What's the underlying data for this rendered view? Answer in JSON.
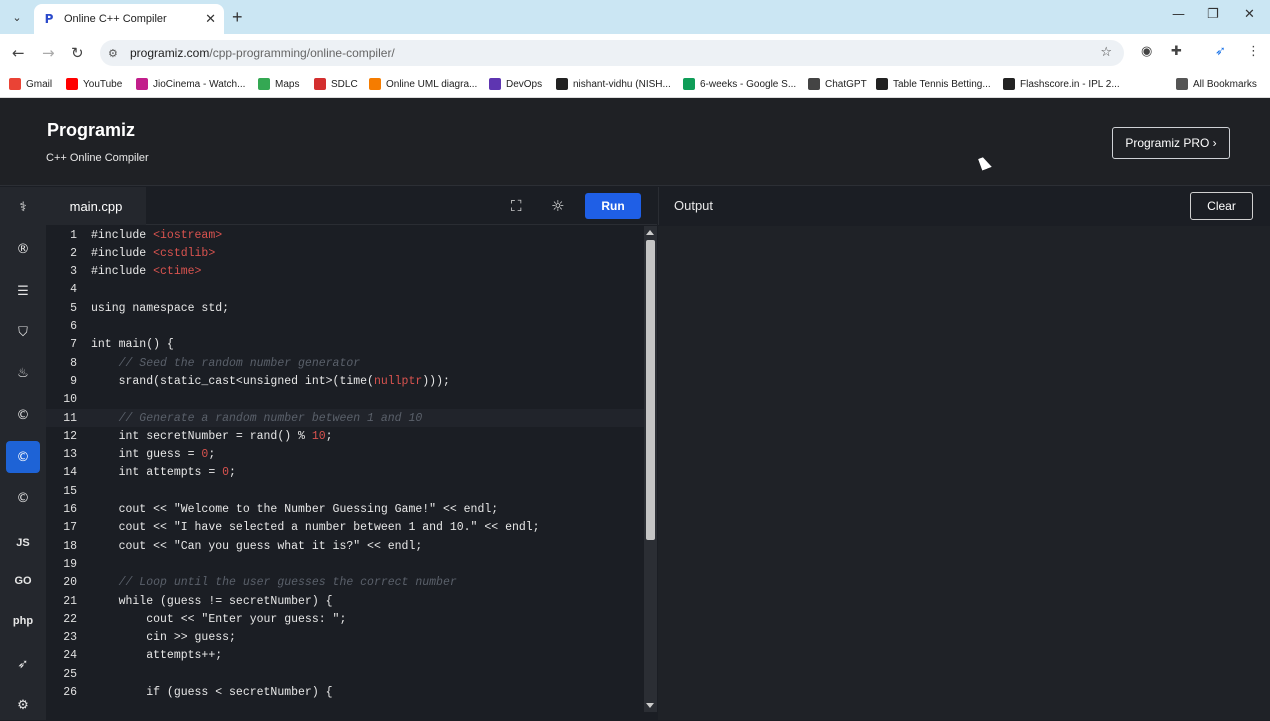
{
  "browser": {
    "tab_title": "Online C++ Compiler",
    "url_domain": "programiz.com",
    "url_path": "/cpp-programming/online-compiler/"
  },
  "bookmarks": [
    {
      "label": "Gmail",
      "color": "#ea4335"
    },
    {
      "label": "YouTube",
      "color": "#ff0000"
    },
    {
      "label": "JioCinema - Watch...",
      "color": "#c21e8b"
    },
    {
      "label": "Maps",
      "color": "#34a853"
    },
    {
      "label": "SDLC",
      "color": "#d32f2f"
    },
    {
      "label": "Online UML diagra...",
      "color": "#f57c00"
    },
    {
      "label": "DevOps",
      "color": "#5e35b1"
    },
    {
      "label": "nishant-vidhu (NISH...",
      "color": "#222222"
    },
    {
      "label": "6-weeks - Google S...",
      "color": "#0f9d58"
    },
    {
      "label": "ChatGPT",
      "color": "#444444"
    },
    {
      "label": "Table Tennis Betting...",
      "color": "#222222"
    },
    {
      "label": "Flashscore.in - IPL 2...",
      "color": "#222222"
    },
    {
      "label": "All Bookmarks",
      "color": "#555555"
    }
  ],
  "header": {
    "logo": "Programiz",
    "subtitle": "C++ Online Compiler",
    "pro_button": "Programiz PRO ›"
  },
  "editor": {
    "file_tab": "main.cpp",
    "run_label": "Run",
    "lines": [
      {
        "n": "1",
        "segs": [
          {
            "c": "tx",
            "t": "#include "
          },
          {
            "c": "inc",
            "t": "<iostream>"
          }
        ]
      },
      {
        "n": "2",
        "segs": [
          {
            "c": "tx",
            "t": "#include "
          },
          {
            "c": "inc",
            "t": "<cstdlib>"
          }
        ]
      },
      {
        "n": "3",
        "segs": [
          {
            "c": "tx",
            "t": "#include "
          },
          {
            "c": "inc",
            "t": "<ctime>"
          }
        ]
      },
      {
        "n": "4",
        "segs": []
      },
      {
        "n": "5",
        "segs": [
          {
            "c": "tx",
            "t": "using namespace std;"
          }
        ]
      },
      {
        "n": "6",
        "segs": []
      },
      {
        "n": "7",
        "segs": [
          {
            "c": "tx",
            "t": "int main() {"
          }
        ]
      },
      {
        "n": "8",
        "segs": [
          {
            "c": "cm",
            "t": "    // Seed the random number generator"
          }
        ]
      },
      {
        "n": "9",
        "segs": [
          {
            "c": "tx",
            "t": "    srand(static_cast<unsigned int>(time("
          },
          {
            "c": "inc",
            "t": "nullptr"
          },
          {
            "c": "tx",
            "t": ")));"
          }
        ]
      },
      {
        "n": "10",
        "segs": []
      },
      {
        "n": "11",
        "segs": [
          {
            "c": "cm",
            "t": "    // Generate a random number between 1 and 10"
          }
        ]
      },
      {
        "n": "12",
        "segs": [
          {
            "c": "tx",
            "t": "    int secretNumber = rand() % "
          },
          {
            "c": "num",
            "t": "10"
          },
          {
            "c": "tx",
            "t": ";"
          }
        ]
      },
      {
        "n": "13",
        "segs": [
          {
            "c": "tx",
            "t": "    int guess = "
          },
          {
            "c": "num",
            "t": "0"
          },
          {
            "c": "tx",
            "t": ";"
          }
        ]
      },
      {
        "n": "14",
        "segs": [
          {
            "c": "tx",
            "t": "    int attempts = "
          },
          {
            "c": "num",
            "t": "0"
          },
          {
            "c": "tx",
            "t": ";"
          }
        ]
      },
      {
        "n": "15",
        "segs": []
      },
      {
        "n": "16",
        "segs": [
          {
            "c": "tx",
            "t": "    cout << \"Welcome to the Number Guessing Game!\" << endl;"
          }
        ]
      },
      {
        "n": "17",
        "segs": [
          {
            "c": "tx",
            "t": "    cout << \"I have selected a number between 1 and 10.\" << endl;"
          }
        ]
      },
      {
        "n": "18",
        "segs": [
          {
            "c": "tx",
            "t": "    cout << \"Can you guess what it is?\" << endl;"
          }
        ]
      },
      {
        "n": "19",
        "segs": []
      },
      {
        "n": "20",
        "segs": [
          {
            "c": "cm",
            "t": "    // Loop until the user guesses the correct number"
          }
        ]
      },
      {
        "n": "21",
        "segs": [
          {
            "c": "tx",
            "t": "    while (guess != secretNumber) {"
          }
        ]
      },
      {
        "n": "22",
        "segs": [
          {
            "c": "tx",
            "t": "        cout << \"Enter your guess: \";"
          }
        ]
      },
      {
        "n": "23",
        "segs": [
          {
            "c": "tx",
            "t": "        cin >> guess;"
          }
        ]
      },
      {
        "n": "24",
        "segs": [
          {
            "c": "tx",
            "t": "        attempts++;"
          }
        ]
      },
      {
        "n": "25",
        "segs": []
      },
      {
        "n": "26",
        "segs": [
          {
            "c": "tx",
            "t": "        if (guess < secretNumber) {"
          }
        ]
      }
    ]
  },
  "output": {
    "title": "Output",
    "clear_label": "Clear"
  },
  "sidebar": [
    "python-icon",
    "r-icon",
    "sql-icon",
    "html-icon",
    "java-icon",
    "c-icon",
    "cpp-icon",
    "csharp-icon",
    "js-icon",
    "go-icon",
    "php-icon",
    "swift-icon",
    "rust-icon"
  ]
}
